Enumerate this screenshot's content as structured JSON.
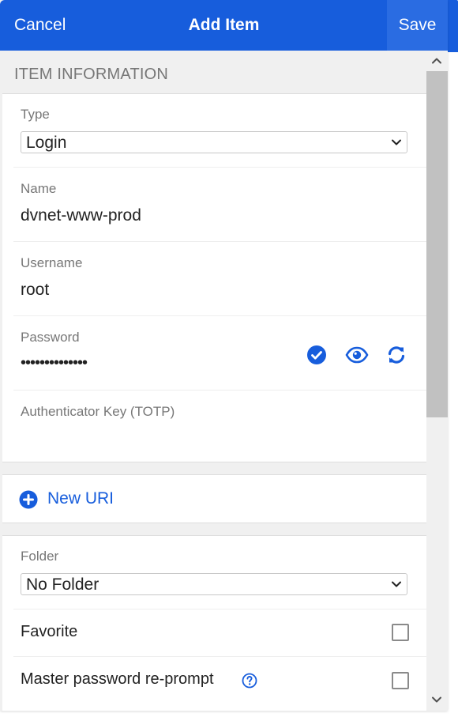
{
  "header": {
    "cancel_label": "Cancel",
    "title": "Add Item",
    "save_label": "Save"
  },
  "item_info": {
    "section_title": "ITEM INFORMATION",
    "type": {
      "label": "Type",
      "value": "Login"
    },
    "name": {
      "label": "Name",
      "value": "dvnet-www-prod"
    },
    "username": {
      "label": "Username",
      "value": "root"
    },
    "password": {
      "label": "Password",
      "value": "••••••••••••••"
    },
    "totp": {
      "label": "Authenticator Key (TOTP)",
      "value": ""
    }
  },
  "uri": {
    "new_uri_label": "New URI"
  },
  "options": {
    "folder": {
      "label": "Folder",
      "value": "No Folder"
    },
    "favorite": {
      "label": "Favorite",
      "checked": false
    },
    "reprompt": {
      "label": "Master password re-prompt",
      "checked": false
    }
  },
  "colors": {
    "brand": "#175ddc",
    "save_bg": "#2a6ce2",
    "background": "#f0f0f0"
  }
}
